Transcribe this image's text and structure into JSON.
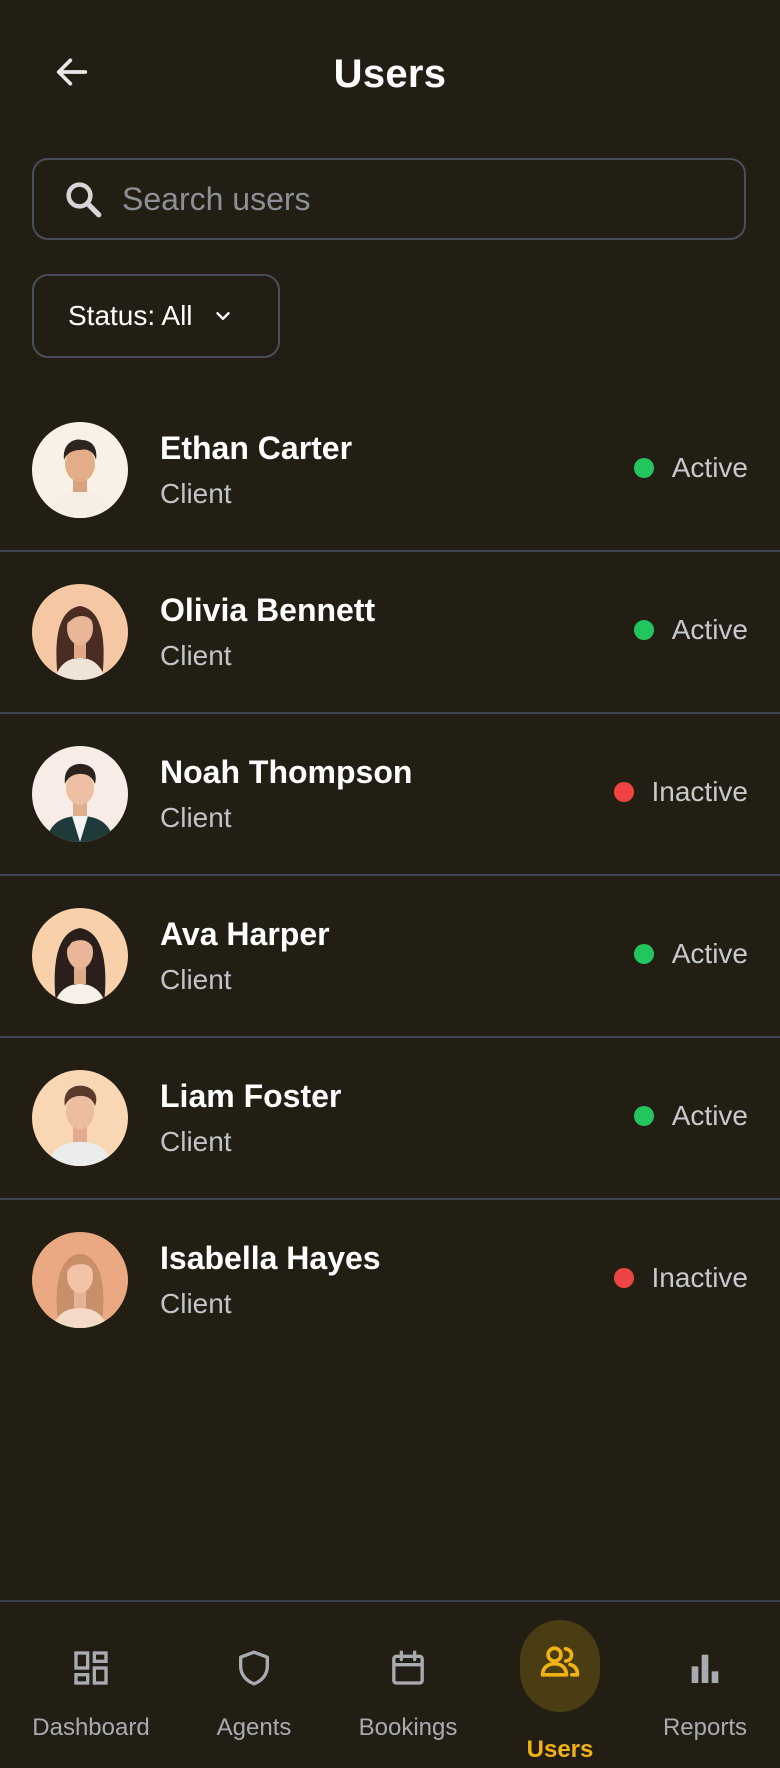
{
  "header": {
    "title": "Users",
    "back_icon": "arrow-left-icon"
  },
  "search": {
    "placeholder": "Search users",
    "value": "",
    "icon": "search-icon"
  },
  "filter": {
    "label": "Status: All",
    "icon": "chevron-down-icon"
  },
  "colors": {
    "background": "#221e13",
    "accent": "#f0b214",
    "active": "#22c55e",
    "inactive": "#ef4444",
    "divider": "#3d4452"
  },
  "users": [
    {
      "name": "Ethan Carter",
      "role": "Client",
      "status": "Active"
    },
    {
      "name": "Olivia Bennett",
      "role": "Client",
      "status": "Active"
    },
    {
      "name": "Noah Thompson",
      "role": "Client",
      "status": "Inactive"
    },
    {
      "name": "Ava Harper",
      "role": "Client",
      "status": "Active"
    },
    {
      "name": "Liam Foster",
      "role": "Client",
      "status": "Active"
    },
    {
      "name": "Isabella Hayes",
      "role": "Client",
      "status": "Inactive"
    }
  ],
  "nav": {
    "items": [
      {
        "label": "Dashboard",
        "icon": "dashboard-icon",
        "active": false
      },
      {
        "label": "Agents",
        "icon": "shield-icon",
        "active": false
      },
      {
        "label": "Bookings",
        "icon": "calendar-icon",
        "active": false
      },
      {
        "label": "Users",
        "icon": "users-icon",
        "active": true
      },
      {
        "label": "Reports",
        "icon": "bar-chart-icon",
        "active": false
      }
    ]
  }
}
